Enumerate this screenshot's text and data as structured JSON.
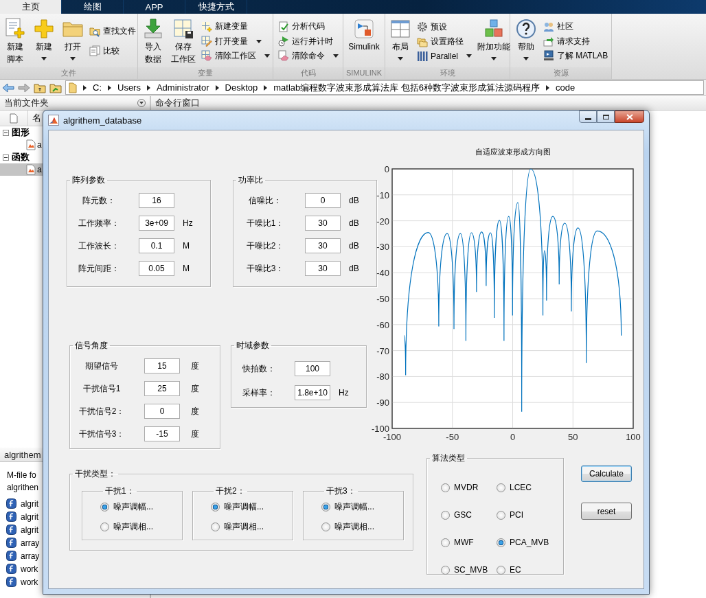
{
  "ribbon_tabs": [
    {
      "label": "主页",
      "selected": true
    },
    {
      "label": "绘图",
      "selected": false
    },
    {
      "label": "APP",
      "selected": false
    },
    {
      "label": "快捷方式",
      "selected": false
    }
  ],
  "ribbon_groups": [
    {
      "label": "文件",
      "columns": [
        {
          "kind": "large",
          "label_lines": [
            "新建",
            "脚本"
          ],
          "dropdown": false
        },
        {
          "kind": "large",
          "label_lines": [
            "新建"
          ],
          "dropdown": true
        },
        {
          "kind": "large",
          "label_lines": [
            "打开"
          ],
          "dropdown": true
        },
        {
          "kind": "stack",
          "items": [
            {
              "label": "查找文件",
              "dropdown": false
            },
            {
              "label": "比较",
              "dropdown": false
            }
          ]
        }
      ]
    },
    {
      "label": "变量",
      "columns": [
        {
          "kind": "large",
          "label_lines": [
            "导入",
            "数据"
          ],
          "dropdown": false
        },
        {
          "kind": "large",
          "label_lines": [
            "保存",
            "工作区"
          ],
          "dropdown": false
        },
        {
          "kind": "stack",
          "items": [
            {
              "label": "新建变量",
              "dropdown": false
            },
            {
              "label": "打开变量",
              "dropdown": true
            },
            {
              "label": "清除工作区",
              "dropdown": true
            }
          ]
        }
      ]
    },
    {
      "label": "代码",
      "columns": [
        {
          "kind": "stack",
          "items": [
            {
              "label": "分析代码",
              "dropdown": false
            },
            {
              "label": "运行并计时",
              "dropdown": false
            },
            {
              "label": "清除命令",
              "dropdown": true
            }
          ]
        }
      ]
    },
    {
      "label": "SIMULINK",
      "columns": [
        {
          "kind": "large",
          "label_lines": [
            "Simulink"
          ],
          "dropdown": false
        }
      ]
    },
    {
      "label": "环境",
      "columns": [
        {
          "kind": "large",
          "label_lines": [
            "布局"
          ],
          "dropdown": true
        },
        {
          "kind": "stack",
          "items": [
            {
              "label": "预设",
              "dropdown": false
            },
            {
              "label": "设置路径",
              "dropdown": false
            },
            {
              "label": "Parallel",
              "dropdown": true
            }
          ]
        },
        {
          "kind": "large",
          "label_lines": [
            "附加功能"
          ],
          "dropdown": true
        }
      ]
    },
    {
      "label": "资源",
      "columns": [
        {
          "kind": "large",
          "label_lines": [
            "帮助"
          ],
          "dropdown": true
        },
        {
          "kind": "stack",
          "items": [
            {
              "label": "社区",
              "dropdown": false
            },
            {
              "label": "请求支持",
              "dropdown": false
            },
            {
              "label": "了解 MATLAB",
              "dropdown": false
            }
          ]
        }
      ]
    }
  ],
  "address_bar": {
    "path": [
      "C:",
      "Users",
      "Administrator",
      "Desktop",
      "matlab编程数字波束形成算法库 包括6种数字波束形成算法源码程序",
      "code"
    ]
  },
  "current_folder": {
    "title": "当前文件夹",
    "column_header": "名",
    "tree": [
      {
        "label": "图形",
        "expanded": true,
        "children": [
          {
            "label": "a",
            "selected": false
          }
        ]
      },
      {
        "label": "函数",
        "expanded": true,
        "children": [
          {
            "label": "a",
            "selected": true
          }
        ]
      }
    ]
  },
  "details": {
    "title": "algrithem",
    "description": [
      "M-file fo",
      "algrithen"
    ],
    "functions": [
      "algrit",
      "algrit",
      "algrit",
      "array",
      "array",
      "work",
      "work"
    ]
  },
  "command_window": {
    "title": "命令行窗口"
  },
  "dialog": {
    "title": "algrithem_database",
    "panels": [
      {
        "title": "阵列参数",
        "rows": [
          {
            "label": "阵元数：",
            "value": "16"
          },
          {
            "label": "工作频率：",
            "value": "3e+09",
            "unit": "Hz"
          },
          {
            "label": "工作波长：",
            "value": "0.1",
            "unit": "M"
          },
          {
            "label": "阵元间距：",
            "value": "0.05",
            "unit": "M"
          }
        ]
      },
      {
        "title": "功率比",
        "rows": [
          {
            "label": "信噪比：",
            "value": "0",
            "unit": "dB"
          },
          {
            "label": "干噪比1：",
            "value": "30",
            "unit": "dB"
          },
          {
            "label": "干噪比2：",
            "value": "30",
            "unit": "dB"
          },
          {
            "label": "干噪比3：",
            "value": "30",
            "unit": "dB"
          }
        ]
      },
      {
        "title": "信号角度",
        "rows": [
          {
            "label": "期望信号",
            "value": "15",
            "unit": "度"
          },
          {
            "label": "干扰信号1",
            "value": "25",
            "unit": "度"
          },
          {
            "label": "干扰信号2：",
            "value": "0",
            "unit": "度"
          },
          {
            "label": "干扰信号3：",
            "value": "-15",
            "unit": "度"
          }
        ]
      },
      {
        "title": "时域参数",
        "rows": [
          {
            "label": "快拍数：",
            "value": "100"
          },
          {
            "label": "采样率：",
            "value": "1.8e+10",
            "unit": "Hz"
          }
        ]
      }
    ],
    "interference_types": {
      "title": "干扰类型：",
      "groups": [
        {
          "title": "干扰1：",
          "options": [
            {
              "label": "噪声调幅...",
              "selected": true
            },
            {
              "label": "噪声调相...",
              "selected": false
            }
          ]
        },
        {
          "title": "干扰2：",
          "options": [
            {
              "label": "噪声调幅...",
              "selected": true
            },
            {
              "label": "噪声调相...",
              "selected": false
            }
          ]
        },
        {
          "title": "干扰3：",
          "options": [
            {
              "label": "噪声调幅...",
              "selected": true
            },
            {
              "label": "噪声调相...",
              "selected": false
            }
          ]
        }
      ]
    },
    "algorithms": {
      "title": "算法类型",
      "options": [
        {
          "label": "MVDR",
          "selected": false
        },
        {
          "label": "LCEC",
          "selected": false
        },
        {
          "label": "GSC",
          "selected": false
        },
        {
          "label": "PCI",
          "selected": false
        },
        {
          "label": "MWF",
          "selected": false
        },
        {
          "label": "PCA_MVB",
          "selected": true
        },
        {
          "label": "SC_MVB",
          "selected": false
        },
        {
          "label": "EC",
          "selected": false
        }
      ]
    },
    "buttons": [
      {
        "label": "Calculate",
        "focused": true
      },
      {
        "label": "reset",
        "focused": false
      }
    ],
    "chart": {
      "chart_data": {
        "type": "line",
        "title": "自适应波束形成方向图",
        "x": [
          -90.1,
          -88.8,
          -70.1,
          -61.3,
          -54.4,
          -48.7,
          -43.4,
          -38.8,
          -34.2,
          -30,
          -25.8,
          -22,
          -18.4,
          -15.2,
          -11,
          -7.2,
          -3.3,
          -0.1,
          4.3,
          7.5,
          15,
          25.1,
          26.4,
          28.1,
          33.3,
          38.6,
          43.2,
          48.7,
          54.2,
          61.1,
          70.1,
          90.1
        ],
        "series": [
          {
            "color": "#0072bd",
            "values": [
              -64.2,
              -79.5,
              -24.5,
              -60.7,
              -24.9,
              -61.7,
              -24.9,
              -66.3,
              -24.6,
              -47.4,
              -24.3,
              -45.1,
              -24.6,
              -57.4,
              -19.8,
              -66.3,
              -18.3,
              -56.5,
              -13,
              -93.6,
              0,
              -56.5,
              -31.5,
              -50.7,
              -18.3,
              -44.5,
              -20.9,
              -54.9,
              -22.7,
              -74.8,
              -23.9,
              -64.2
            ]
          }
        ],
        "grid": true,
        "xlim": [
          -100,
          100
        ],
        "ylim": [
          -100,
          0
        ],
        "xticks": [
          -100,
          -50,
          0,
          50,
          100
        ],
        "yticks": [
          0,
          -10,
          -20,
          -30,
          -40,
          -50,
          -60,
          -70,
          -80,
          -90,
          -100
        ]
      }
    }
  }
}
